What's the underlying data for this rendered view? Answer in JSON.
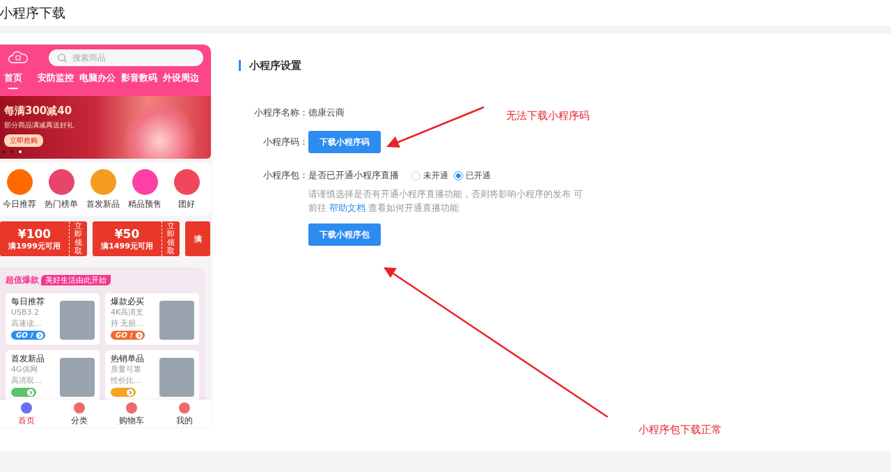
{
  "page_title": "小程序下载",
  "preview": {
    "search": {
      "placeholder": "搜索商品"
    },
    "tabs": [
      {
        "label": "首页",
        "selected": true
      },
      {
        "label": "安防监控",
        "selected": false
      },
      {
        "label": "电脑办公",
        "selected": false
      },
      {
        "label": "影音数码",
        "selected": false
      },
      {
        "label": "外设周边",
        "selected": false
      }
    ],
    "banner": {
      "headline": "每满300减40",
      "subline": "部分商品满减再送好礼",
      "button": "立即抢购",
      "dots": [
        {
          "selected": false
        },
        {
          "selected": false
        },
        {
          "selected": true
        }
      ]
    },
    "shortcuts": [
      {
        "label": "今日推荐",
        "color": "#ff6a00"
      },
      {
        "label": "热门榜单",
        "color": "#e8456b"
      },
      {
        "label": "首发新品",
        "color": "#f39c1f"
      },
      {
        "label": "精品预售",
        "color": "#ff3fa4"
      },
      {
        "label": "团好",
        "color": "#f0475a"
      }
    ],
    "coupons": [
      {
        "amount": "¥100",
        "condition": "满1999元可用",
        "action": "立即领取"
      },
      {
        "amount": "¥50",
        "condition": "满1499元可用",
        "action": "立即领取"
      },
      {
        "condition": "满"
      }
    ],
    "section": {
      "title": "超值爆款",
      "tag": "美好生活由此开始"
    },
    "products": [
      {
        "title": "每日推荐",
        "desc": [
          "USB3.2",
          "高速读..."
        ],
        "go": "GO！",
        "color": "#2f8ff0"
      },
      {
        "title": "爆款必买",
        "desc": [
          "4K高清支",
          "持 无损..."
        ],
        "go": "GO！",
        "color": "#f26a2a"
      },
      {
        "title": "首发新品",
        "desc": [
          "4G供网",
          "高清双..."
        ],
        "color": "#5cc36b"
      },
      {
        "title": "热销单品",
        "desc": [
          "质量可靠",
          "性价比..."
        ],
        "color": "#f5a623"
      }
    ],
    "bottom_nav": [
      {
        "label": "首页",
        "selected": true
      },
      {
        "label": "分类",
        "selected": false
      },
      {
        "label": "购物车",
        "selected": false
      },
      {
        "label": "我的",
        "selected": false
      }
    ]
  },
  "settings": {
    "title": "小程序设置",
    "name_label": "小程序名称：",
    "name_value": "德康云商",
    "code_label": "小程序码：",
    "code_button": "下载小程序码",
    "package_label": "小程序包：",
    "live_question": "是否已开通小程序直播",
    "live_options": [
      {
        "label": "未开通",
        "selected": false
      },
      {
        "label": "已开通",
        "selected": true
      }
    ],
    "hint_before": "请谨慎选择是否有开通小程序直播功能，否则将影响小程序的发布 可前往",
    "hint_link": "帮助文档",
    "hint_after": "查看如何开通直播功能",
    "package_button": "下载小程序包"
  },
  "annotations": [
    {
      "text": "无法下载小程序码"
    },
    {
      "text": "小程序包下载正常"
    }
  ]
}
